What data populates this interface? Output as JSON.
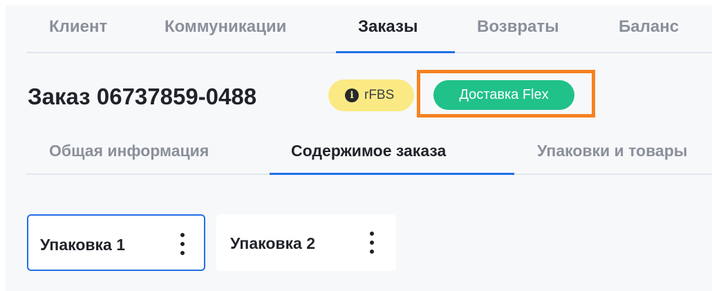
{
  "top_tabs": [
    {
      "label": "Клиент",
      "active": false
    },
    {
      "label": "Коммуникации",
      "active": false
    },
    {
      "label": "Заказы",
      "active": true
    },
    {
      "label": "Возвраты",
      "active": false
    },
    {
      "label": "Баланс",
      "active": false
    }
  ],
  "order": {
    "title": "Заказ 06737859-0488",
    "badges": {
      "info_icon_glyph": "i",
      "rfbs_label": "rFBS",
      "delivery_label": "Доставка Flex"
    }
  },
  "sub_tabs": [
    {
      "label": "Общая информация",
      "active": false
    },
    {
      "label": "Содержимое заказа",
      "active": true
    },
    {
      "label": "Упаковки и товары",
      "active": false
    }
  ],
  "packages": [
    {
      "label": "Упаковка 1",
      "selected": true
    },
    {
      "label": "Упаковка 2",
      "selected": false
    }
  ],
  "colors": {
    "accent": "#1f6fe5",
    "rfbs_badge": "#fbe984",
    "delivery_badge": "#21c18a",
    "highlight": "#f58221"
  },
  "icons": {
    "info": "info-icon",
    "package_menu": "kebab-menu-icon"
  }
}
